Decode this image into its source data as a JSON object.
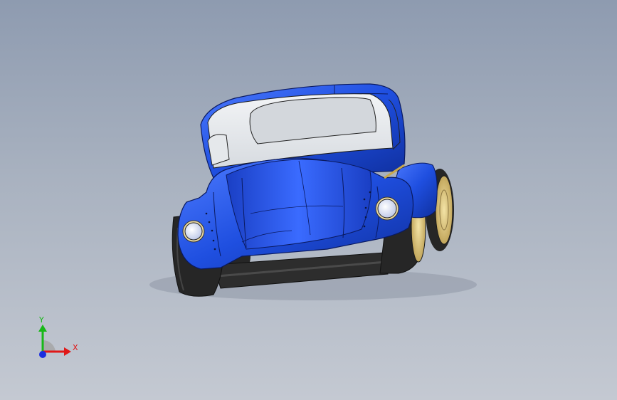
{
  "viewport": {
    "background_top": "#8e9bb0",
    "background_bottom": "#c4c9d2"
  },
  "model": {
    "body_color": "#1f4fe0",
    "body_shadow": "#0f2f9e",
    "window_color": "#e9ecef",
    "tire_color": "#2a2a2a",
    "rim_color": "#d9c27a",
    "headlight_color": "#cfd6ea"
  },
  "triad": {
    "x_label": "X",
    "y_label": "Y",
    "x_color": "#e01818",
    "y_color": "#18b818",
    "z_color": "#1a2ee0"
  }
}
